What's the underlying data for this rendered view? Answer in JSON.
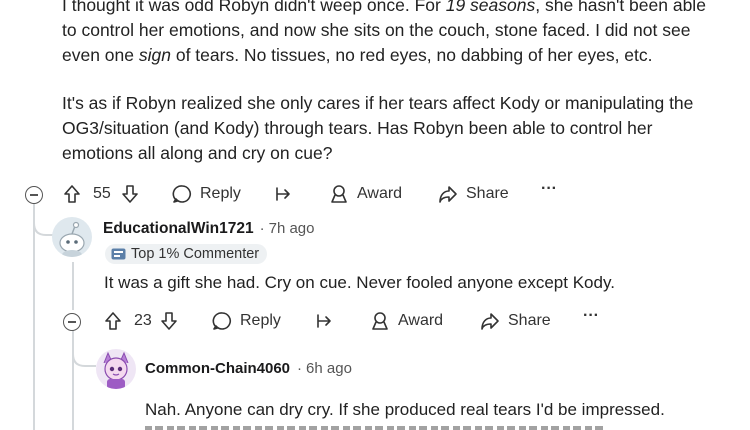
{
  "post": {
    "paragraph1": [
      {
        "parts": [
          [
            "I thought it was odd Robyn didn't weep once. For ",
            ""
          ],
          [
            "19 seasons",
            "i"
          ],
          [
            ", she hasn't been able",
            ""
          ]
        ]
      },
      {
        "parts": [
          [
            "to control her emotions, and now she sits on the couch, stone faced. I did not see",
            ""
          ]
        ]
      },
      {
        "parts": [
          [
            "even one ",
            ""
          ],
          [
            "sign",
            "i"
          ],
          [
            " of tears. No tissues, no red eyes, no dabbing of her eyes, etc.",
            ""
          ]
        ]
      }
    ],
    "paragraph2": [
      "It's as if Robyn realized she only cares if her tears affect Kody or manipulating the",
      "OG3/situation (and Kody) through tears. Has Robyn been able to control her",
      "emotions all along and cry on cue?"
    ],
    "actions": {
      "votes": "55",
      "reply": "Reply",
      "award": "Award",
      "share": "Share",
      "more": "···"
    }
  },
  "comment1": {
    "username": "EducationalWin1721",
    "separator": "·",
    "time": "7h ago",
    "badge": "Top 1% Commenter",
    "text": "It was a gift she had. Cry on cue. Never fooled anyone except Kody.",
    "actions": {
      "votes": "23",
      "reply": "Reply",
      "award": "Award",
      "share": "Share",
      "more": "···"
    }
  },
  "comment2": {
    "username": "Common-Chain4060",
    "separator": "·",
    "time": "6h ago",
    "text": "Nah. Anyone can dry cry. If she produced real tears I'd be impressed."
  }
}
